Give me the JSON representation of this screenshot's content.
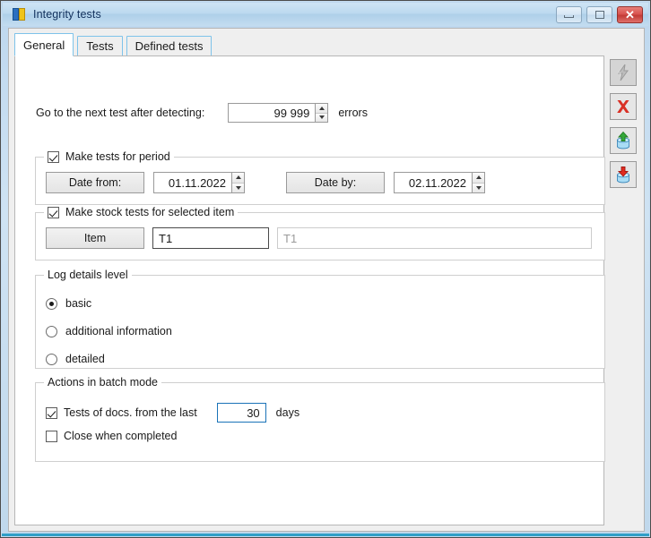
{
  "window": {
    "title": "Integrity tests",
    "icon": "integrity-tests-icon",
    "buttons": {
      "minimize": "minimize",
      "maximize": "maximize",
      "close": "close"
    }
  },
  "tabs": [
    {
      "label": "General",
      "active": true
    },
    {
      "label": "Tests",
      "active": false
    },
    {
      "label": "Defined tests",
      "active": false
    }
  ],
  "general": {
    "next_test_label": "Go to the next test after detecting:",
    "next_test_value": "99 999",
    "errors_label": "errors",
    "period_group": {
      "title": "Make tests for period",
      "checked": true,
      "date_from_button": "Date from:",
      "date_from_value": "01.11.2022",
      "date_by_button": "Date by:",
      "date_by_value": "02.11.2022"
    },
    "stock_group": {
      "title": "Make stock tests for selected item",
      "checked": true,
      "item_button": "Item",
      "item_code_value": "T1",
      "item_name_value": "T1"
    },
    "log_group": {
      "title": "Log details level",
      "options": [
        {
          "label": "basic",
          "selected": true
        },
        {
          "label": "additional information",
          "selected": false
        },
        {
          "label": "detailed",
          "selected": false
        }
      ]
    },
    "batch_group": {
      "title": "Actions in batch mode",
      "docs_checkbox_label": "Tests of docs. from the last",
      "docs_checked": true,
      "docs_days_value": "30",
      "days_label": "days",
      "close_checkbox_label": "Close when completed",
      "close_checked": false
    }
  },
  "toolbar": [
    {
      "name": "run-tests-button",
      "icon": "lightning-bolt-icon",
      "enabled": false
    },
    {
      "name": "cancel-button",
      "icon": "red-x-icon",
      "enabled": true
    },
    {
      "name": "load-settings-button",
      "icon": "database-import-icon",
      "enabled": true
    },
    {
      "name": "save-settings-button",
      "icon": "database-export-icon",
      "enabled": true
    }
  ],
  "colors": {
    "titlebar_accent": "#bcd9ef",
    "close_red": "#d9534f",
    "tab_border": "#7ec3ea",
    "focus_blue": "#1a73b8",
    "frame_accent": "#2f9fc7"
  }
}
